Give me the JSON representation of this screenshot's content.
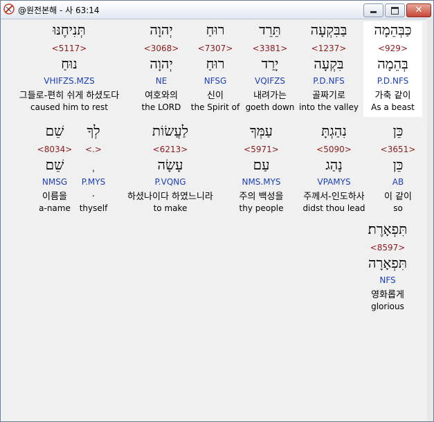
{
  "window": {
    "title": "@원전본해 - 사 63:14",
    "icon": "app-logo-icon",
    "controls": {
      "minimize": "minimize-icon",
      "maximize": "maximize-icon",
      "close": "✕"
    }
  },
  "words": [
    {
      "heb": "כַּבְּהֵמָה",
      "strong": "<929>",
      "lemma": "בְּהֵמָה",
      "parse": "P.D.NFS",
      "kor": "가축 같이",
      "eng": "As a beast",
      "highlight": true
    },
    {
      "heb": "בַּבִּקְעָה",
      "strong": "<1237>",
      "lemma": "בִּקְעָה",
      "parse": "P.D.NFS",
      "kor": "골짜기로",
      "eng": "into the valley",
      "highlight": false
    },
    {
      "heb": "תֵּרֵד",
      "strong": "<3381>",
      "lemma": "יָרַד",
      "parse": "VQIFZS",
      "kor": "내려가는",
      "eng": "goeth down",
      "highlight": false
    },
    {
      "heb": "רוּחַ",
      "strong": "<7307>",
      "lemma": "רוּחַ",
      "parse": "NFSG",
      "kor": "신이",
      "eng": "the Spirit of",
      "highlight": false
    },
    {
      "heb": "יְהוָה",
      "strong": "<3068>",
      "lemma": "יְהוָה",
      "parse": "NE",
      "kor": "여호와의",
      "eng": "the LORD",
      "highlight": false
    },
    {
      "heb": "תְּנִיחֶנּוּ",
      "strong": "<5117>",
      "lemma": "נוּחַ",
      "parse": "VHIFZS.MZS",
      "kor": "그들로-편히 쉬게 하셨도다",
      "eng": "caused him to rest",
      "highlight": false
    },
    {
      "heb": "כֵּן",
      "strong": "<3651>",
      "lemma": "כֵּן",
      "parse": "AB",
      "kor": "이 같이",
      "eng": "so",
      "highlight": false
    },
    {
      "heb": "נִהַגְתָּ",
      "strong": "<5090>",
      "lemma": "נָהַג",
      "parse": "VPAMYS",
      "kor": "주께서-인도하사",
      "eng": "didst thou lead",
      "highlight": false
    },
    {
      "heb": "עַמְּךָ",
      "strong": "<5971>",
      "lemma": "עַם",
      "parse": "NMS.MYS",
      "kor": "주의 백성을",
      "eng": "thy people",
      "highlight": false
    },
    {
      "heb": "לַעֲשׂוֹת",
      "strong": "<6213>",
      "lemma": "עָשָׂה",
      "parse": "P.VQNG",
      "kor": "하셨나이다 하였느니라",
      "eng": "to make",
      "highlight": false
    },
    {
      "heb": "לְךָ",
      "strong": "<.>",
      "lemma": "ְ",
      "parse": "P.MYS",
      "kor": ".",
      "eng": "thyself",
      "highlight": false
    },
    {
      "heb": "שֵׁם",
      "strong": "<8034>",
      "lemma": "שֵׁם",
      "parse": "NMSG",
      "kor": "이름을",
      "eng": "a-name",
      "highlight": false
    },
    {
      "heb": "תִּפְאָרֶת׃",
      "strong": "<8597>",
      "lemma": "תִּפְאָרָה",
      "parse": "NFS",
      "kor": "영화롭게",
      "eng": "glorious",
      "highlight": false
    }
  ]
}
